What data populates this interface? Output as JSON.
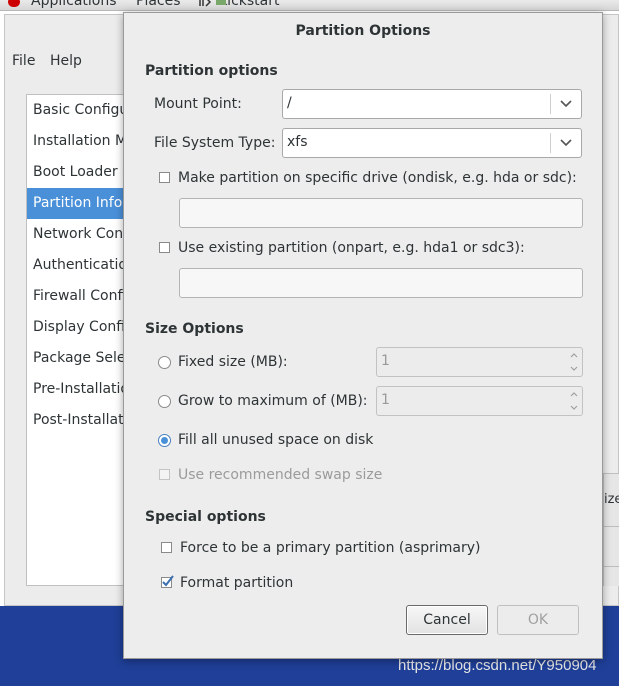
{
  "topbar": {
    "applications": "Applications",
    "places": "Places",
    "kickstart": "Kickstart"
  },
  "menubar": {
    "file": "File",
    "help": "Help"
  },
  "sidebar": {
    "items": [
      {
        "label": "Basic Configuration"
      },
      {
        "label": "Installation Method"
      },
      {
        "label": "Boot Loader Options"
      },
      {
        "label": "Partition Information"
      },
      {
        "label": "Network Configuration"
      },
      {
        "label": "Authentication"
      },
      {
        "label": "Firewall Configuration"
      },
      {
        "label": "Display Configuration"
      },
      {
        "label": "Package Selection"
      },
      {
        "label": "Pre-Installation Script"
      },
      {
        "label": "Post-Installation Script"
      }
    ]
  },
  "background_right": {
    "text": "ize"
  },
  "dialog": {
    "title": "Partition Options",
    "partition_options_heading": "Partition options",
    "mount_point": {
      "label": "Mount Point:",
      "value": "/"
    },
    "fs_type": {
      "label": "File System Type:",
      "value": "xfs"
    },
    "ondisk": {
      "label": "Make partition on specific drive (ondisk, e.g. hda or sdc):",
      "value": ""
    },
    "onpart": {
      "label": "Use existing partition (onpart, e.g. hda1 or sdc3):",
      "value": ""
    },
    "size_options_heading": "Size Options",
    "fixed_size": {
      "label": "Fixed size (MB):",
      "value": "1"
    },
    "grow_max": {
      "label": "Grow to maximum of (MB):",
      "value": "1"
    },
    "fill_all": {
      "label": "Fill all unused space on disk"
    },
    "recommended_swap": {
      "label": "Use recommended swap size"
    },
    "special_options_heading": "Special options",
    "primary": {
      "label": "Force to be a primary partition (asprimary)"
    },
    "format": {
      "label": "Format partition"
    },
    "cancel_label": "Cancel",
    "ok_label": "OK"
  },
  "watermark": "https://blog.csdn.net/Y950904",
  "colors": {
    "accent": "#4a90d9",
    "desktop": "#1f3f98"
  }
}
